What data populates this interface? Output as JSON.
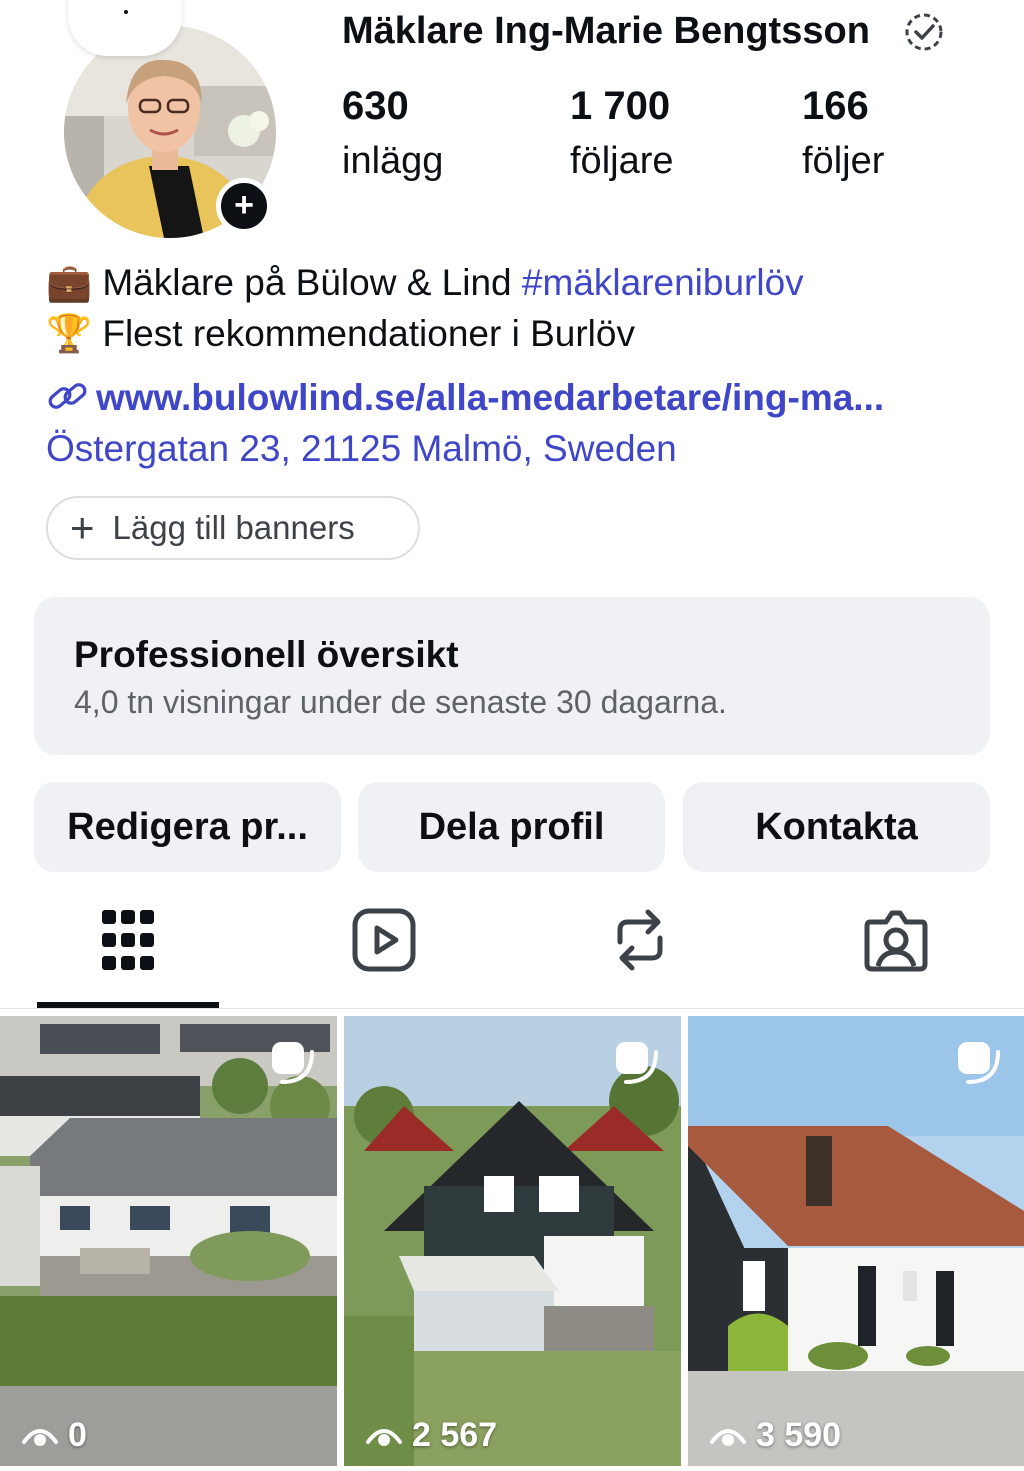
{
  "profile": {
    "name": "Mäklare Ing-Marie Bengtsson",
    "stats": [
      {
        "value": "630",
        "label": "inlägg"
      },
      {
        "value": "1 700",
        "label": "följare"
      },
      {
        "value": "166",
        "label": "följer"
      }
    ],
    "bio": {
      "line1_emoji": "💼",
      "line1_text": "Mäklare på Bülow & Lind",
      "line1_hashtag": "#mäklareniburlöv",
      "line2_emoji": "🏆",
      "line2_text": "Flest rekommendationer i Burlöv"
    },
    "link": "www.bulowlind.se/alla-medarbetare/ing-ma...",
    "address": "Östergatan 23, 21125 Malmö, Sweden"
  },
  "banner_button": "Lägg till banners",
  "dashboard": {
    "title": "Professionell översikt",
    "subtitle": "4,0 tn visningar under de senaste 30 dagarna."
  },
  "actions": {
    "edit": "Redigera pr...",
    "share": "Dela profil",
    "contact": "Kontakta"
  },
  "tabs": [
    "grid-icon",
    "reels-icon",
    "reposts-icon",
    "tagged-icon"
  ],
  "posts": [
    {
      "views": "0"
    },
    {
      "views": "2 567"
    },
    {
      "views": "3 590"
    }
  ],
  "colors": {
    "link": "#3f46c8",
    "button_bg": "#eff1f4",
    "text": "#0c1014"
  }
}
